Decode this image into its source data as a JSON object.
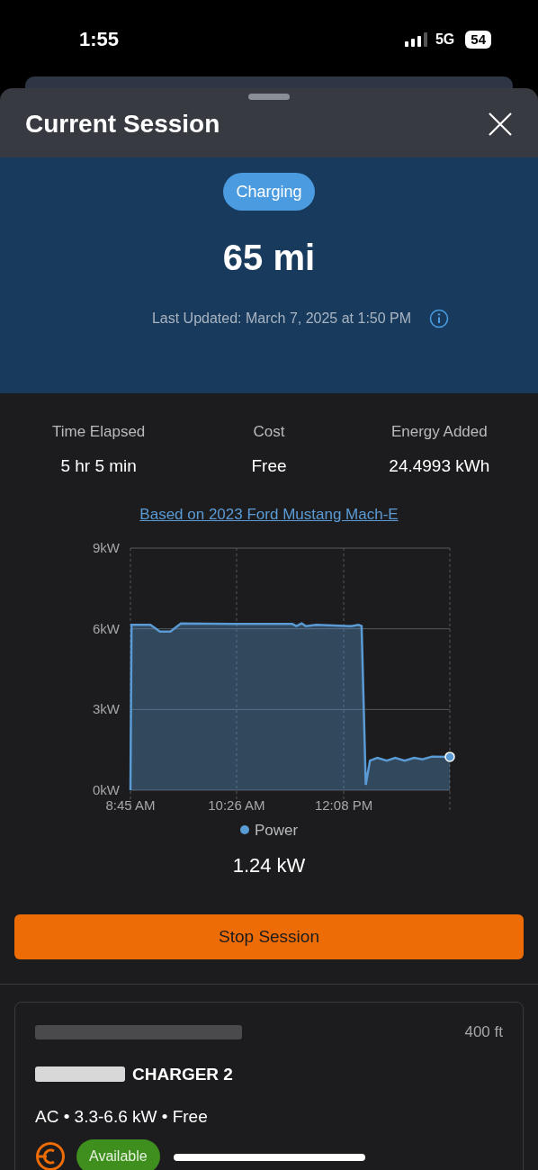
{
  "status_bar": {
    "time": "1:55",
    "network": "5G",
    "battery": "54"
  },
  "sheet": {
    "title": "Current Session"
  },
  "summary": {
    "status": "Charging",
    "range": "65 mi",
    "last_updated": "Last Updated: March 7, 2025 at 1:50 PM"
  },
  "stats": [
    {
      "label": "Time Elapsed",
      "value": "5 hr 5 min"
    },
    {
      "label": "Cost",
      "value": "Free"
    },
    {
      "label": "Energy Added",
      "value": "24.4993 kWh"
    }
  ],
  "vehicle_link": "Based on 2023 Ford Mustang Mach-E",
  "chart": {
    "reading": "1.24 kW",
    "chart_data": {
      "type": "area",
      "grid": true,
      "xlim": [
        8.75,
        13.8167
      ],
      "ylim": [
        0,
        9
      ],
      "xticks": [
        {
          "value": 8.75,
          "label": "8:45 AM"
        },
        {
          "value": 10.4333,
          "label": "10:26 AM"
        },
        {
          "value": 12.1333,
          "label": "12:08 PM"
        }
      ],
      "yticks": [
        {
          "value": 0,
          "label": "0kW"
        },
        {
          "value": 3,
          "label": "3kW"
        },
        {
          "value": 6,
          "label": "6kW"
        },
        {
          "value": 9,
          "label": "9kW"
        }
      ],
      "x": [
        8.75,
        8.767,
        9.067,
        9.217,
        9.383,
        9.55,
        10.383,
        11.317,
        11.383,
        11.467,
        11.533,
        11.7,
        12.25,
        12.367,
        12.417,
        12.483,
        12.55,
        12.667,
        12.817,
        12.95,
        13.1,
        13.25,
        13.383,
        13.533,
        13.8167
      ],
      "series": [
        {
          "name": "Power",
          "color": "#5b9bd5",
          "values": [
            0,
            6.15,
            6.15,
            5.9,
            5.9,
            6.2,
            6.18,
            6.18,
            6.1,
            6.2,
            6.1,
            6.15,
            6.1,
            6.15,
            6.1,
            0.2,
            1.1,
            1.2,
            1.1,
            1.2,
            1.1,
            1.2,
            1.15,
            1.25,
            1.24
          ]
        }
      ]
    }
  },
  "stop_button": "Stop Session",
  "station": {
    "distance": "400 ft",
    "name": "CHARGER 2",
    "details": "AC • 3.3-6.6 kW • Free",
    "availability": "Available"
  }
}
